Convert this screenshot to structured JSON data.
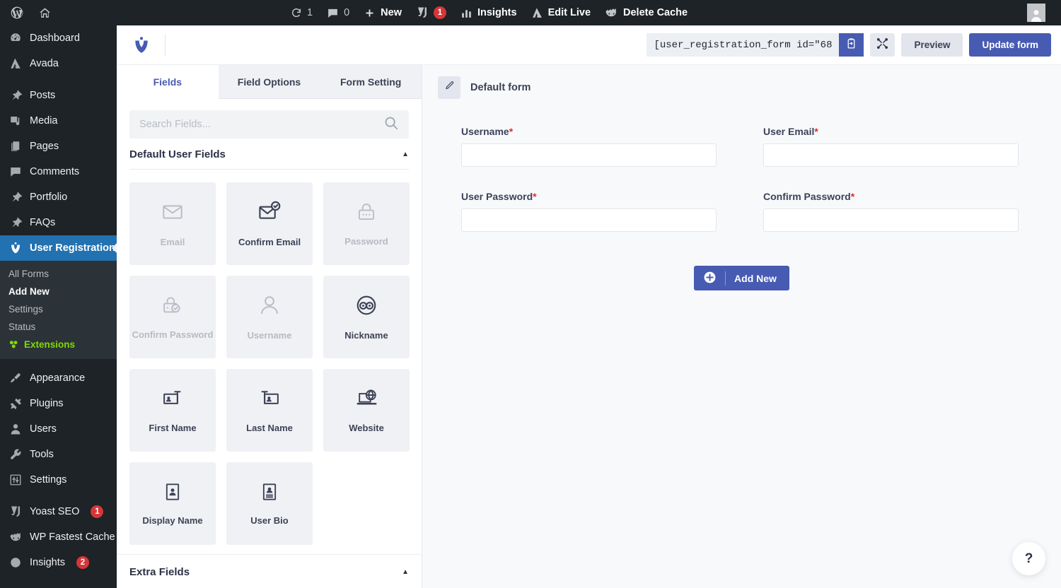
{
  "adminbar": {
    "left": [
      {
        "name": "wordpress-logo-icon",
        "label": ""
      },
      {
        "name": "site-home-icon",
        "label": ""
      }
    ],
    "updates_count": "1",
    "comments_count": "0",
    "new_label": "New",
    "yoast_badge": "1",
    "insights_label": "Insights",
    "edit_live_label": "Edit Live",
    "delete_cache_label": "Delete Cache"
  },
  "sidebar": {
    "items": [
      {
        "label": "Dashboard",
        "icon": "dashboard-icon"
      },
      {
        "label": "Avada",
        "icon": "avada-icon"
      },
      {
        "label": "Posts",
        "icon": "pin-icon"
      },
      {
        "label": "Media",
        "icon": "media-icon"
      },
      {
        "label": "Pages",
        "icon": "pages-icon"
      },
      {
        "label": "Comments",
        "icon": "comment-icon"
      },
      {
        "label": "Portfolio",
        "icon": "pin-icon"
      },
      {
        "label": "FAQs",
        "icon": "pin-icon"
      },
      {
        "label": "User Registration",
        "icon": "user-registration-icon",
        "current": true
      },
      {
        "label": "Appearance",
        "icon": "brush-icon"
      },
      {
        "label": "Plugins",
        "icon": "plug-icon"
      },
      {
        "label": "Users",
        "icon": "users-icon"
      },
      {
        "label": "Tools",
        "icon": "wrench-icon"
      },
      {
        "label": "Settings",
        "icon": "settings-icon"
      },
      {
        "label": "Yoast SEO",
        "icon": "yoast-icon",
        "badge": "1"
      },
      {
        "label": "WP Fastest Cache",
        "icon": "cache-icon"
      },
      {
        "label": "Insights",
        "icon": "insights-icon",
        "badge": "2"
      }
    ],
    "submenu": [
      {
        "label": "All Forms"
      },
      {
        "label": "Add New",
        "current": true
      },
      {
        "label": "Settings"
      },
      {
        "label": "Status"
      },
      {
        "label": "Extensions",
        "highlight": true
      }
    ]
  },
  "header": {
    "logo_icon": "user-registration-logo-icon",
    "shortcode_value": "[user_registration_form id=\"68",
    "copy_icon": "clipboard-copy-icon",
    "fullscreen_icon": "fullscreen-expand-icon",
    "preview_label": "Preview",
    "update_label": "Update form",
    "accent_color": "#475bb2"
  },
  "left_panel": {
    "tabs": [
      {
        "label": "Fields",
        "active": true
      },
      {
        "label": "Field Options",
        "active": false
      },
      {
        "label": "Form Setting",
        "active": false
      }
    ],
    "search": {
      "placeholder": "Search Fields...",
      "value": "",
      "icon": "search-icon"
    },
    "default_section": {
      "title": "Default User Fields",
      "collapse_icon": "caret-up-icon"
    },
    "default_fields": [
      {
        "label": "Email",
        "icon": "envelope-icon",
        "disabled": true
      },
      {
        "label": "Confirm Email",
        "icon": "envelope-check-icon",
        "disabled": false
      },
      {
        "label": "Password",
        "icon": "lock-dots-icon",
        "disabled": true
      },
      {
        "label": "Confirm Password",
        "icon": "lock-check-icon",
        "disabled": true
      },
      {
        "label": "Username",
        "icon": "user-icon",
        "disabled": true
      },
      {
        "label": "Nickname",
        "icon": "glasses-icon",
        "disabled": false
      },
      {
        "label": "First Name",
        "icon": "id-card-left-icon",
        "disabled": false
      },
      {
        "label": "Last Name",
        "icon": "id-card-right-icon",
        "disabled": false
      },
      {
        "label": "Website",
        "icon": "globe-laptop-icon",
        "disabled": false
      },
      {
        "label": "Display Name",
        "icon": "id-portrait-icon",
        "disabled": false
      },
      {
        "label": "User Bio",
        "icon": "id-bio-icon",
        "disabled": false
      }
    ],
    "extra_section": {
      "title": "Extra Fields",
      "collapse_icon": "caret-up-icon"
    }
  },
  "right_panel": {
    "form_title": "Default form",
    "edit_icon": "pencil-icon",
    "fields": [
      {
        "label": "Username",
        "required": true,
        "value": ""
      },
      {
        "label": "User Email",
        "required": true,
        "value": ""
      },
      {
        "label": "User Password",
        "required": true,
        "value": ""
      },
      {
        "label": "Confirm Password",
        "required": true,
        "value": ""
      }
    ],
    "add_new_label": "Add New",
    "add_new_icon": "plus-circle-icon",
    "help_label": "?"
  }
}
